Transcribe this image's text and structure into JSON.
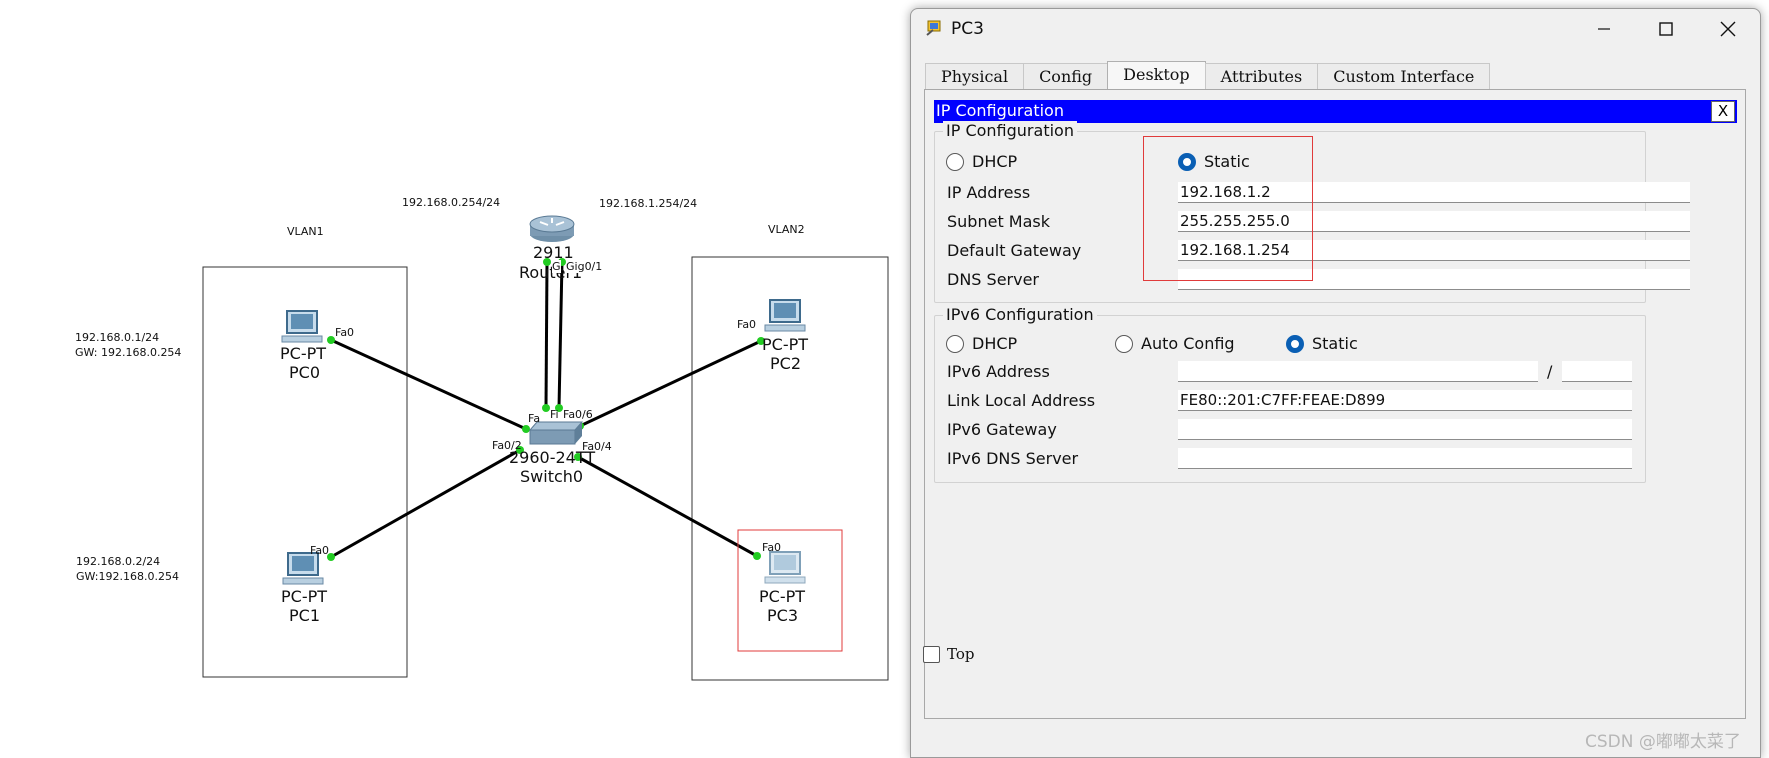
{
  "topology": {
    "vlan1_label": "VLAN1",
    "vlan2_label": "VLAN2",
    "router_ip_left": "192.168.0.254/24",
    "router_ip_right": "192.168.1.254/24",
    "router": {
      "model": "2911",
      "name": "Router1",
      "ports": [
        "G",
        "Gig0/1"
      ]
    },
    "switch": {
      "model": "2960-24TT",
      "name": "Switch0",
      "ports": [
        "Fa",
        "Fi",
        "Fa0/6",
        "Fa0/2",
        "Fa0/4"
      ]
    },
    "pcs": [
      {
        "type": "PC-PT",
        "name": "PC0",
        "port": "Fa0",
        "ip": "192.168.0.1/24",
        "gw": "GW:  192.168.0.254"
      },
      {
        "type": "PC-PT",
        "name": "PC1",
        "port": "Fa0",
        "ip": "192.168.0.2/24",
        "gw": "GW:192.168.0.254"
      },
      {
        "type": "PC-PT",
        "name": "PC2",
        "port": "Fa0"
      },
      {
        "type": "PC-PT",
        "name": "PC3",
        "port": "Fa0"
      }
    ],
    "colors": {
      "link": "#000000",
      "port_dot": "#22cc22",
      "highlight": "#e03b3b"
    }
  },
  "window": {
    "title": "PC3",
    "tabs": [
      "Physical",
      "Config",
      "Desktop",
      "Attributes",
      "Custom Interface"
    ],
    "active_tab": "Desktop",
    "panel_title": "IP Configuration",
    "panel_close": "X",
    "ipv4": {
      "group_title": "IP Configuration",
      "dhcp_label": "DHCP",
      "static_label": "Static",
      "selected_mode": "Static",
      "ip_label": "IP Address",
      "ip_value": "192.168.1.2",
      "mask_label": "Subnet Mask",
      "mask_value": "255.255.255.0",
      "gateway_label": "Default Gateway",
      "gateway_value": "192.168.1.254",
      "dns_label": "DNS Server",
      "dns_value": ""
    },
    "ipv6": {
      "group_title": "IPv6 Configuration",
      "dhcp_label": "DHCP",
      "auto_label": "Auto Config",
      "static_label": "Static",
      "selected_mode": "Static",
      "address_label": "IPv6 Address",
      "address_value": "",
      "prefix_sep": "/",
      "prefix_value": "",
      "link_local_label": "Link Local Address",
      "link_local_value": "FE80::201:C7FF:FEAE:D899",
      "gateway_label": "IPv6 Gateway",
      "gateway_value": "",
      "dns_label": "IPv6 DNS Server",
      "dns_value": ""
    },
    "top_checkbox_label": "Top",
    "accent": "#0000ff",
    "radio_color": "#0a5fb4"
  },
  "watermark": "CSDN @嘟嘟太菜了"
}
